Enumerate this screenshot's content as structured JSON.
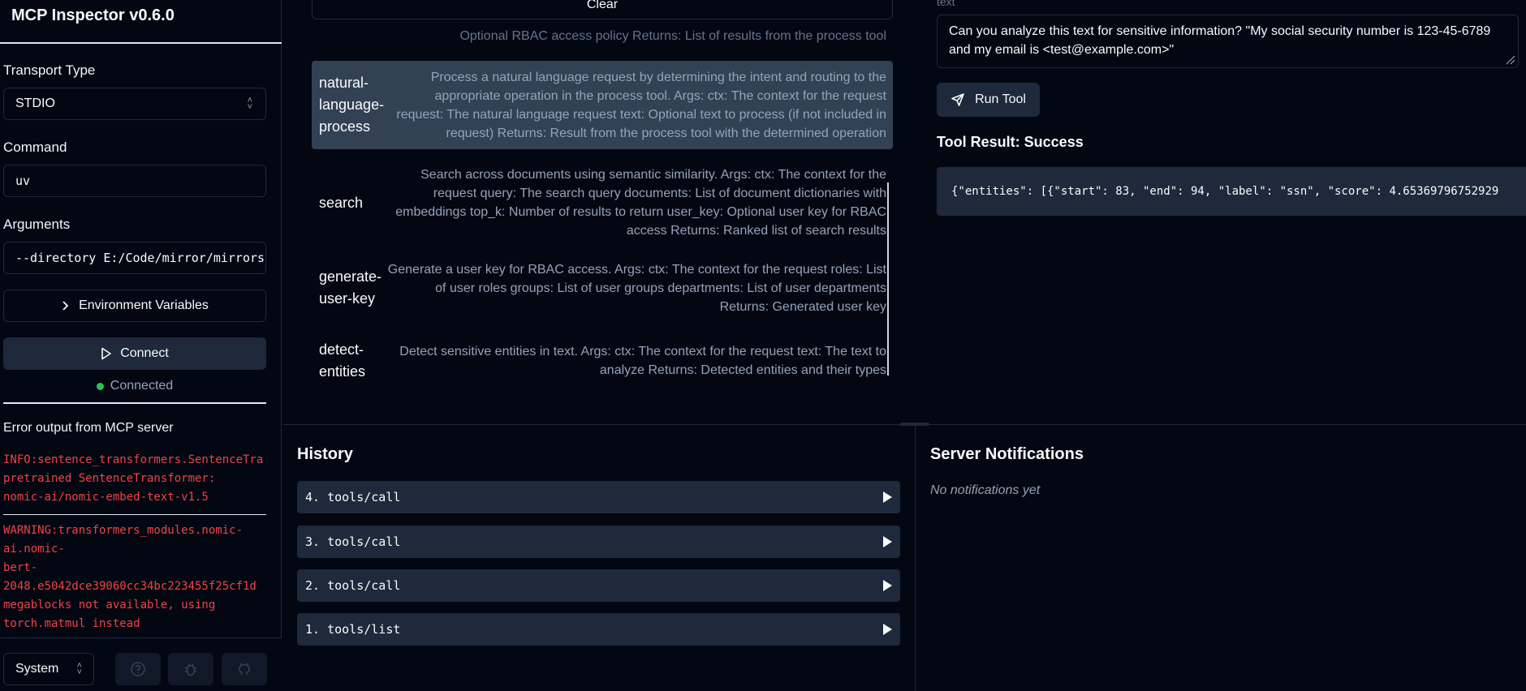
{
  "app": {
    "title": "MCP Inspector v0.6.0"
  },
  "sidebar": {
    "transport_label": "Transport Type",
    "transport_value": "STDIO",
    "command_label": "Command",
    "command_value": "uv",
    "arguments_label": "Arguments",
    "arguments_value": "--directory E:/Code/mirror/mirrors",
    "env_button": "Environment Variables",
    "connect_button": "Connect",
    "status_text": "Connected",
    "error_title": "Error output from MCP server",
    "errors": [
      "INFO:sentence_transformers.SentenceTra\npretrained SentenceTransformer:\nnomic-ai/nomic-embed-text-v1.5",
      "WARNING:transformers_modules.nomic-\nai.nomic-\nbert-\n2048.e5042dce39060cc34bc223455f25cf1d\nmegablocks not available, using\ntorch.matmul instead"
    ],
    "theme_value": "System"
  },
  "tools": {
    "clear_button": "Clear",
    "cutoff_text": "Optional RBAC access policy Returns: List of results from the process tool",
    "items": [
      {
        "name": "natural-language-process",
        "description": "Process a natural language request by determining the intent and routing to the appropriate operation in the process tool. Args: ctx: The context for the request request: The natural language request text: Optional text to process (if not included in request) Returns: Result from the process tool with the determined operation"
      },
      {
        "name": "search",
        "description": "Search across documents using semantic similarity. Args: ctx: The context for the request query: The search query documents: List of document dictionaries with embeddings top_k: Number of results to return user_key: Optional user key for RBAC access Returns: Ranked list of search results"
      },
      {
        "name": "generate-user-key",
        "description": "Generate a user key for RBAC access. Args: ctx: The context for the request roles: List of user roles groups: List of user groups departments: List of user departments Returns: Generated user key"
      },
      {
        "name": "detect-entities",
        "description": "Detect sensitive entities in text. Args: ctx: The context for the request text: The text to analyze Returns: Detected entities and their types"
      }
    ]
  },
  "tool_pane": {
    "text_label": "text",
    "text_value": "Can you analyze this text for sensitive information? \"My social security number is 123-45-6789 and my email is <test@example.com>\"",
    "run_button": "Run Tool",
    "result_title": "Tool Result: Success",
    "result_value": "{\"entities\": [{\"start\": 83, \"end\": 94, \"label\": \"ssn\", \"score\": 4.65369796752929"
  },
  "history": {
    "title": "History",
    "items": [
      "4. tools/call",
      "3. tools/call",
      "2. tools/call",
      "1. tools/list"
    ]
  },
  "notifications": {
    "title": "Server Notifications",
    "empty_text": "No notifications yet"
  }
}
